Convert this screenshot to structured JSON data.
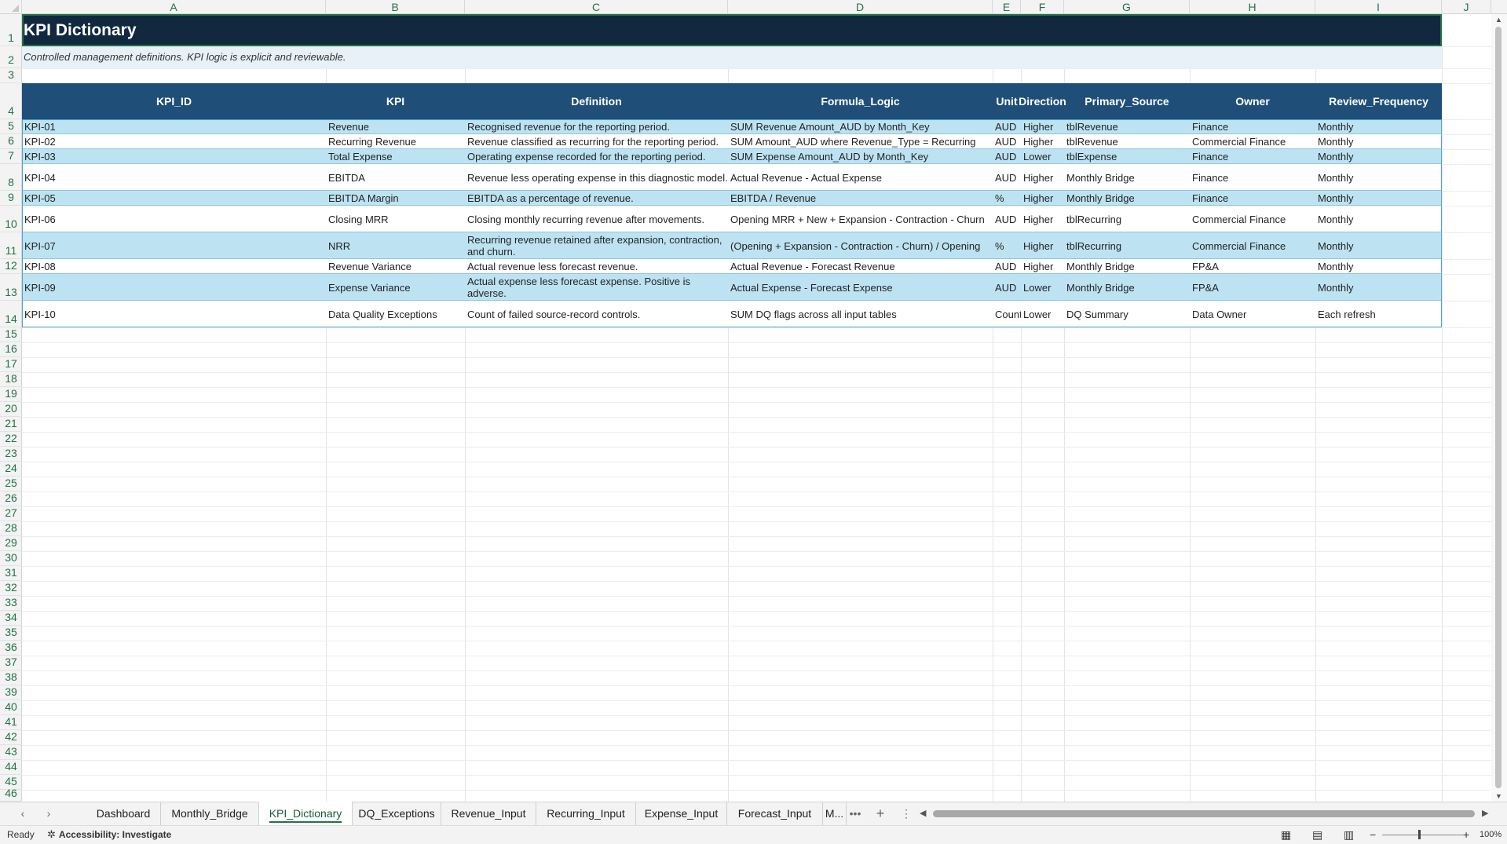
{
  "columns": [
    "A",
    "B",
    "C",
    "D",
    "E",
    "F",
    "G",
    "H",
    "I",
    "J"
  ],
  "rows_numbers": [
    "1",
    "2",
    "3",
    "4",
    "5",
    "6",
    "7",
    "8",
    "9",
    "10",
    "11",
    "12",
    "13",
    "14",
    "15",
    "16",
    "17",
    "18",
    "19",
    "20",
    "21",
    "22",
    "23",
    "24",
    "25",
    "26",
    "27",
    "28",
    "29",
    "30",
    "31",
    "32",
    "33",
    "34",
    "35",
    "36",
    "37",
    "38",
    "39",
    "40",
    "41",
    "42",
    "43",
    "44",
    "45",
    "46"
  ],
  "sheet": {
    "title": "KPI Dictionary",
    "subtitle": "Controlled management definitions. KPI logic is explicit and reviewable.",
    "headers": [
      "KPI_ID",
      "KPI",
      "Definition",
      "Formula_Logic",
      "Unit",
      "Direction",
      "Primary_Source",
      "Owner",
      "Review_Frequency"
    ],
    "rows": [
      [
        "KPI-01",
        "Revenue",
        "Recognised revenue for the reporting period.",
        "SUM Revenue Amount_AUD by Month_Key",
        "AUD",
        "Higher",
        "tblRevenue",
        "Finance",
        "Monthly"
      ],
      [
        "KPI-02",
        "Recurring Revenue",
        "Revenue classified as recurring for the reporting period.",
        "SUM Amount_AUD where Revenue_Type = Recurring",
        "AUD",
        "Higher",
        "tblRevenue",
        "Commercial Finance",
        "Monthly"
      ],
      [
        "KPI-03",
        "Total Expense",
        "Operating expense recorded for the reporting period.",
        "SUM Expense Amount_AUD by Month_Key",
        "AUD",
        "Lower",
        "tblExpense",
        "Finance",
        "Monthly"
      ],
      [
        "KPI-04",
        "EBITDA",
        "Revenue less operating expense in this diagnostic model.",
        "Actual Revenue - Actual Expense",
        "AUD",
        "Higher",
        "Monthly Bridge",
        "Finance",
        "Monthly"
      ],
      [
        "KPI-05",
        "EBITDA Margin",
        "EBITDA as a percentage of revenue.",
        "EBITDA / Revenue",
        "%",
        "Higher",
        "Monthly Bridge",
        "Finance",
        "Monthly"
      ],
      [
        "KPI-06",
        "Closing MRR",
        "Closing monthly recurring revenue after movements.",
        "Opening MRR + New + Expansion - Contraction - Churn",
        "AUD",
        "Higher",
        "tblRecurring",
        "Commercial Finance",
        "Monthly"
      ],
      [
        "KPI-07",
        "NRR",
        "Recurring revenue retained after expansion, contraction, and churn.",
        "(Opening + Expansion - Contraction - Churn) / Opening",
        "%",
        "Higher",
        "tblRecurring",
        "Commercial Finance",
        "Monthly"
      ],
      [
        "KPI-08",
        "Revenue Variance",
        "Actual revenue less forecast revenue.",
        "Actual Revenue - Forecast Revenue",
        "AUD",
        "Higher",
        "Monthly Bridge",
        "FP&A",
        "Monthly"
      ],
      [
        "KPI-09",
        "Expense Variance",
        "Actual expense less forecast expense. Positive is adverse.",
        "Actual Expense - Forecast Expense",
        "AUD",
        "Lower",
        "Monthly Bridge",
        "FP&A",
        "Monthly"
      ],
      [
        "KPI-10",
        "Data Quality Exceptions",
        "Count of failed source-record controls.",
        "SUM DQ flags across all input tables",
        "Count",
        "Lower",
        "DQ Summary",
        "Data Owner",
        "Each refresh"
      ]
    ]
  },
  "tabs": [
    "Dashboard",
    "Monthly_Bridge",
    "KPI_Dictionary",
    "DQ_Exceptions",
    "Revenue_Input",
    "Recurring_Input",
    "Expense_Input",
    "Forecast_Input",
    "M..."
  ],
  "active_tab": "KPI_Dictionary",
  "tab_more": "•••",
  "tab_add": "+",
  "tab_options": "⋮",
  "status": {
    "ready": "Ready",
    "accessibility": "Accessibility: Investigate",
    "zoom": "100%"
  },
  "colors": {
    "title_bg": "#12283f",
    "header_bg": "#1f4e79",
    "band_blue": "#bde3f2",
    "accent_green": "#217346"
  }
}
